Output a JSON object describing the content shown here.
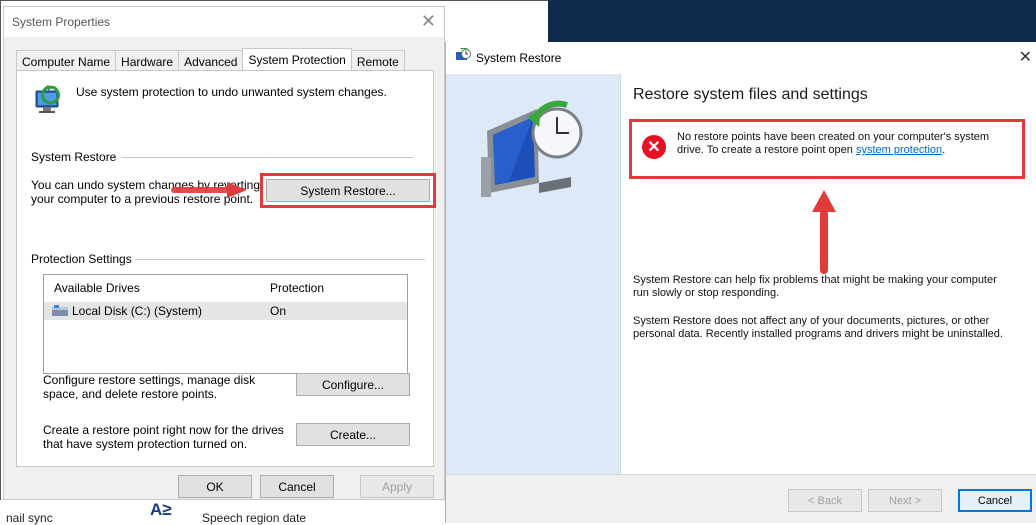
{
  "background": {
    "left_text": "nail sync",
    "speech_text": "Speech region date",
    "glyph": "A≥"
  },
  "system_properties": {
    "title": "System Properties",
    "close_glyph": "✕",
    "tabs": [
      {
        "label": "Computer Name"
      },
      {
        "label": "Hardware"
      },
      {
        "label": "Advanced"
      },
      {
        "label": "System Protection",
        "active": true
      },
      {
        "label": "Remote"
      }
    ],
    "intro": "Use system protection to undo unwanted system changes.",
    "system_restore": {
      "heading": "System Restore",
      "text": "You can undo system changes by reverting your computer to a previous restore point.",
      "button": "System Restore..."
    },
    "protection": {
      "heading": "Protection Settings",
      "col_drives": "Available Drives",
      "col_protection": "Protection",
      "rows": [
        {
          "drive": "Local Disk (C:) (System)",
          "protection": "On"
        }
      ]
    },
    "configure": {
      "text": "Configure restore settings, manage disk space, and delete restore points.",
      "button": "Configure..."
    },
    "create": {
      "text": "Create a restore point right now for the drives that have system protection turned on.",
      "button": "Create..."
    },
    "footer": {
      "ok": "OK",
      "cancel": "Cancel",
      "apply": "Apply"
    }
  },
  "system_restore_window": {
    "title": "System Restore",
    "close_glyph": "✕",
    "heading": "Restore system files and settings",
    "error": {
      "text_before": "No restore points have been created on your computer's system drive. To create a restore point open ",
      "link": "system protection",
      "text_after": "."
    },
    "info1": "System Restore can help fix problems that might be making your computer run slowly or stop responding.",
    "info2": "System Restore does not affect any of your documents, pictures, or other personal data. Recently installed programs and drivers might be uninstalled.",
    "buttons": {
      "back": "< Back",
      "next": "Next >",
      "cancel": "Cancel"
    }
  },
  "annotations": {
    "highlight_color": "#e03a3a"
  }
}
